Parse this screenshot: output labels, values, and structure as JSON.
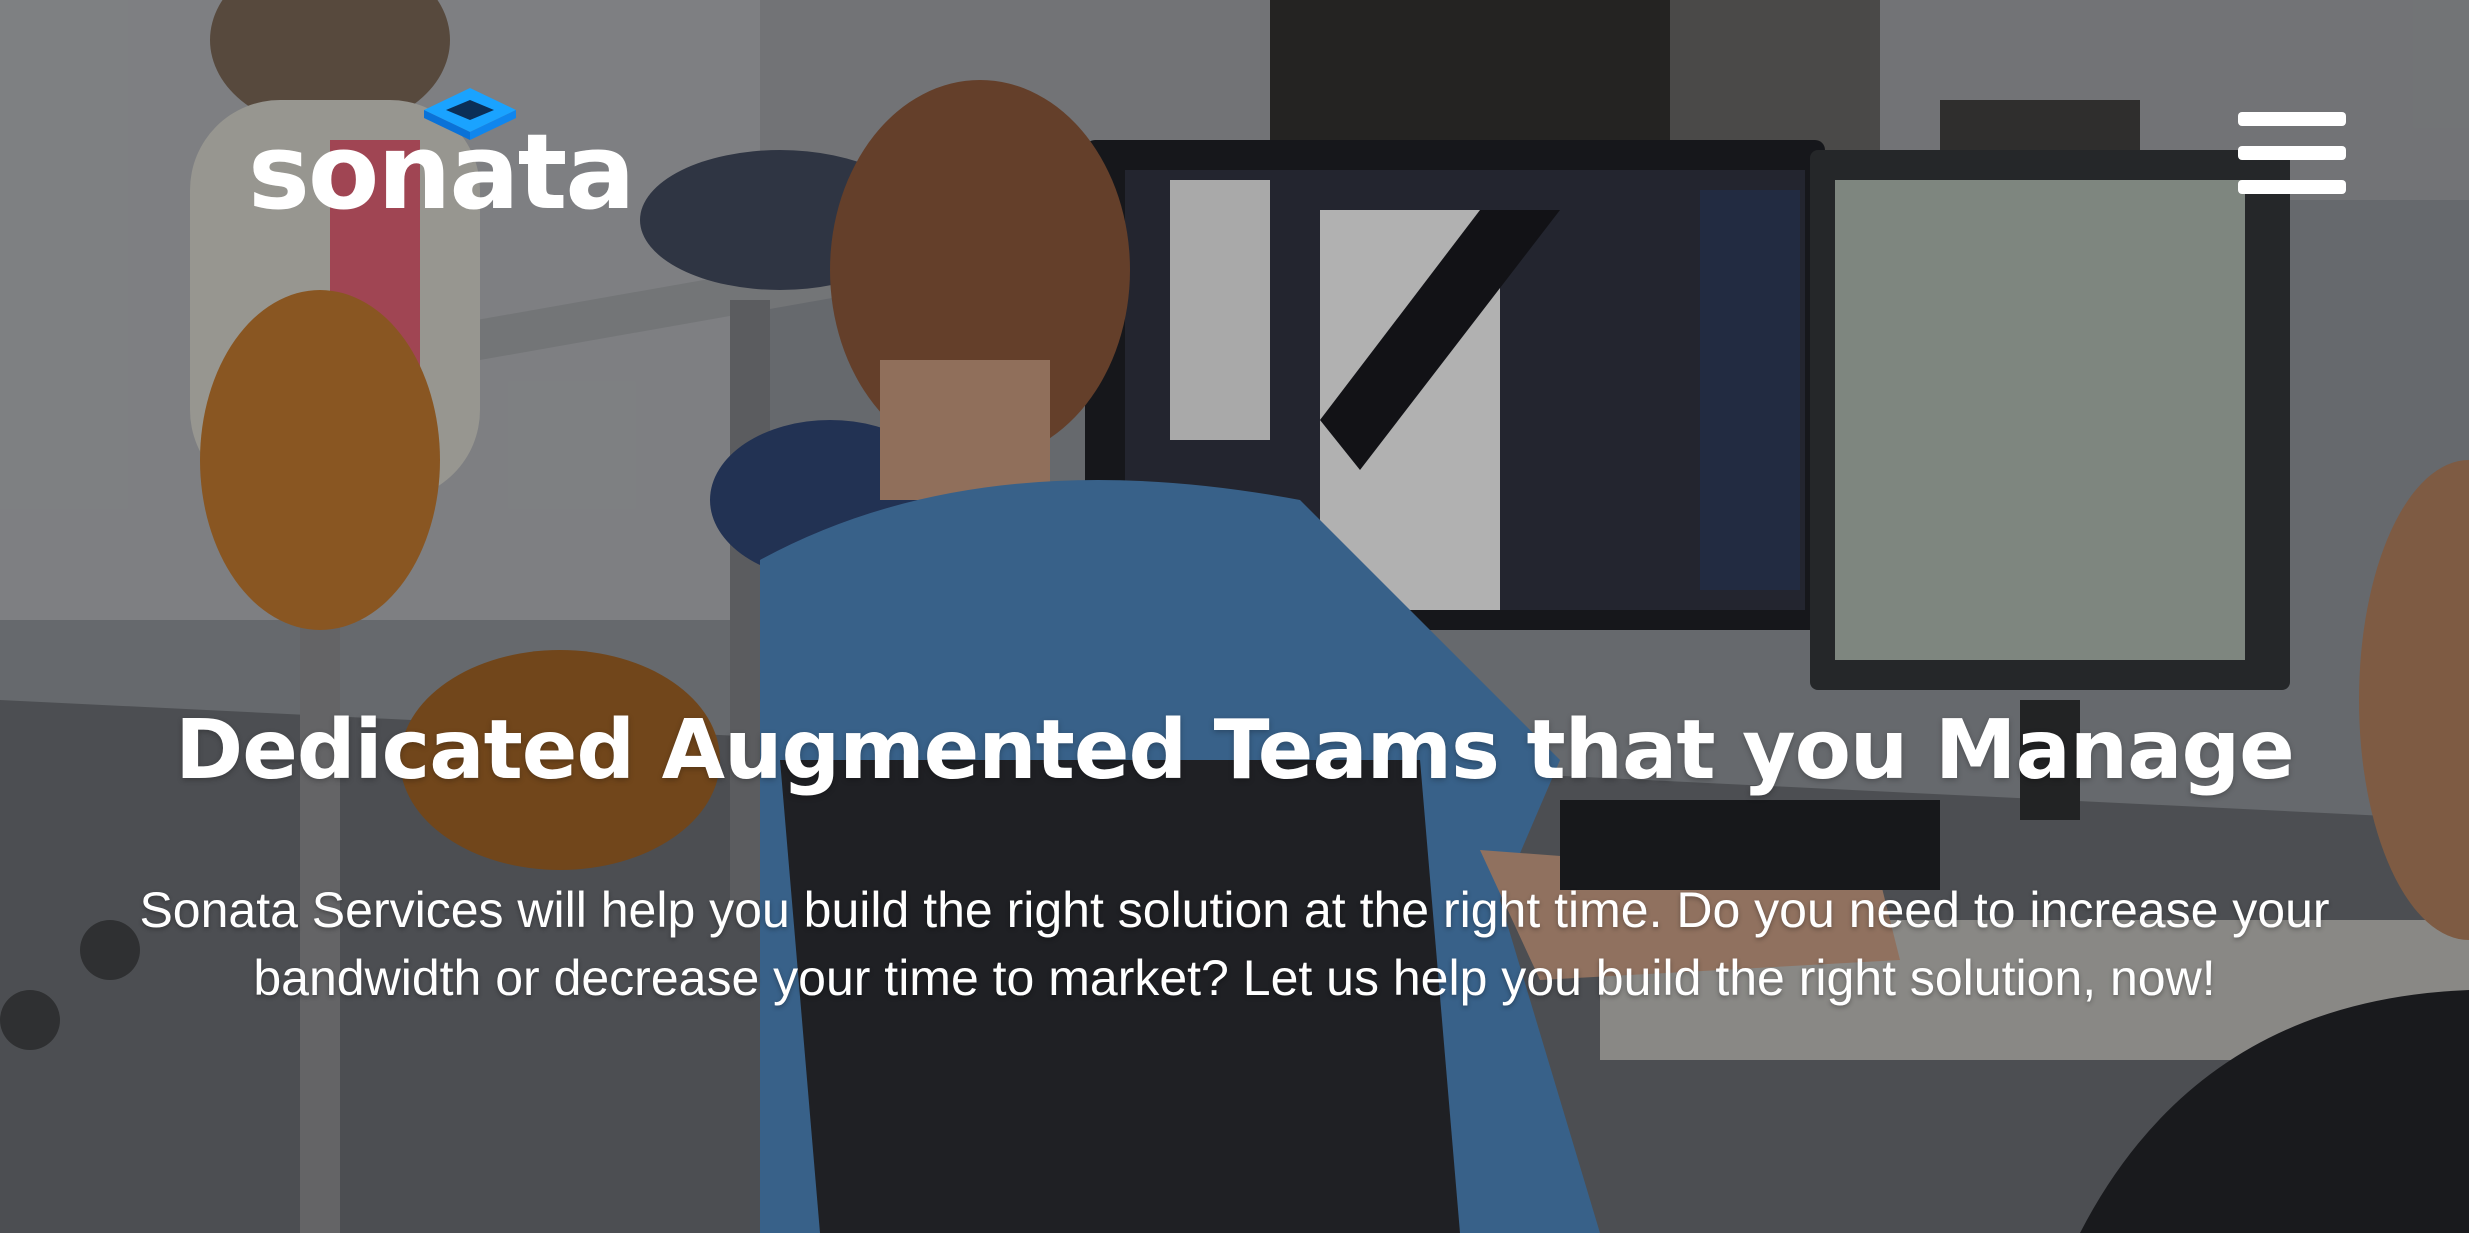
{
  "header": {
    "logo_text": "sonata",
    "logo_mark_icon": "sonata-diamond-mark-icon",
    "menu_icon": "hamburger-menu-icon"
  },
  "hero": {
    "title": "Dedicated Augmented Teams that you Manage",
    "subtitle": "Sonata Services will help you build the right solution at the right time. Do you need to increase your bandwidth or decrease your time to market? Let us help you build the right solution, now!",
    "background_image": "office-developer-at-dual-monitors-photo"
  },
  "colors": {
    "logo_accent": "#1aa3ff",
    "logo_accent_dark": "#0a72d8",
    "text": "#ffffff"
  }
}
